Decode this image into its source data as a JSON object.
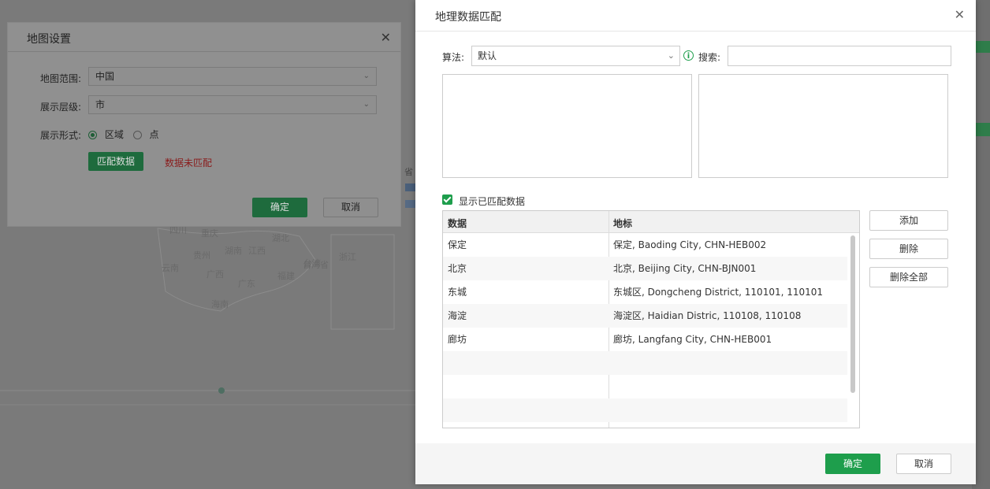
{
  "background": {
    "map_labels": [
      "四川",
      "重庆",
      "湖北",
      "贵州",
      "湖南",
      "江西",
      "浙江",
      "云南",
      "广西",
      "广东",
      "福建",
      "台湾",
      "台湾省",
      "海南",
      "省"
    ]
  },
  "map_settings_dialog": {
    "title": "地图设置",
    "map_range_label": "地图范围:",
    "map_range_value": "中国",
    "display_level_label": "展示层级:",
    "display_level_value": "市",
    "display_form_label": "展示形式:",
    "display_form_options": [
      {
        "label": "区域",
        "selected": true
      },
      {
        "label": "点",
        "selected": false
      }
    ],
    "match_button": "匹配数据",
    "unmatched_status": "数据未匹配",
    "ok": "确定",
    "cancel": "取消"
  },
  "geo_match_dialog": {
    "title": "地理数据匹配",
    "algorithm_label": "算法:",
    "algorithm_value": "默认",
    "search_label": "搜索:",
    "search_value": "",
    "show_matched_label": "显示已匹配数据",
    "show_matched_checked": true,
    "table": {
      "headers": [
        "数据",
        "地标"
      ],
      "rows": [
        [
          "保定",
          "保定, Baoding City, CHN-HEB002"
        ],
        [
          "北京",
          "北京, Beijing City, CHN-BJN001"
        ],
        [
          "东城",
          "东城区, Dongcheng District, 110101, 110101"
        ],
        [
          "海淀",
          "海淀区, Haidian Distric, 110108, 110108"
        ],
        [
          "廊坊",
          "廊坊, Langfang City, CHN-HEB001"
        ]
      ]
    },
    "side_buttons": {
      "add": "添加",
      "delete": "删除",
      "delete_all": "删除全部"
    },
    "ok": "确定",
    "cancel": "取消"
  },
  "colors": {
    "accent": "#1e9e4c",
    "error": "#d9363e"
  }
}
